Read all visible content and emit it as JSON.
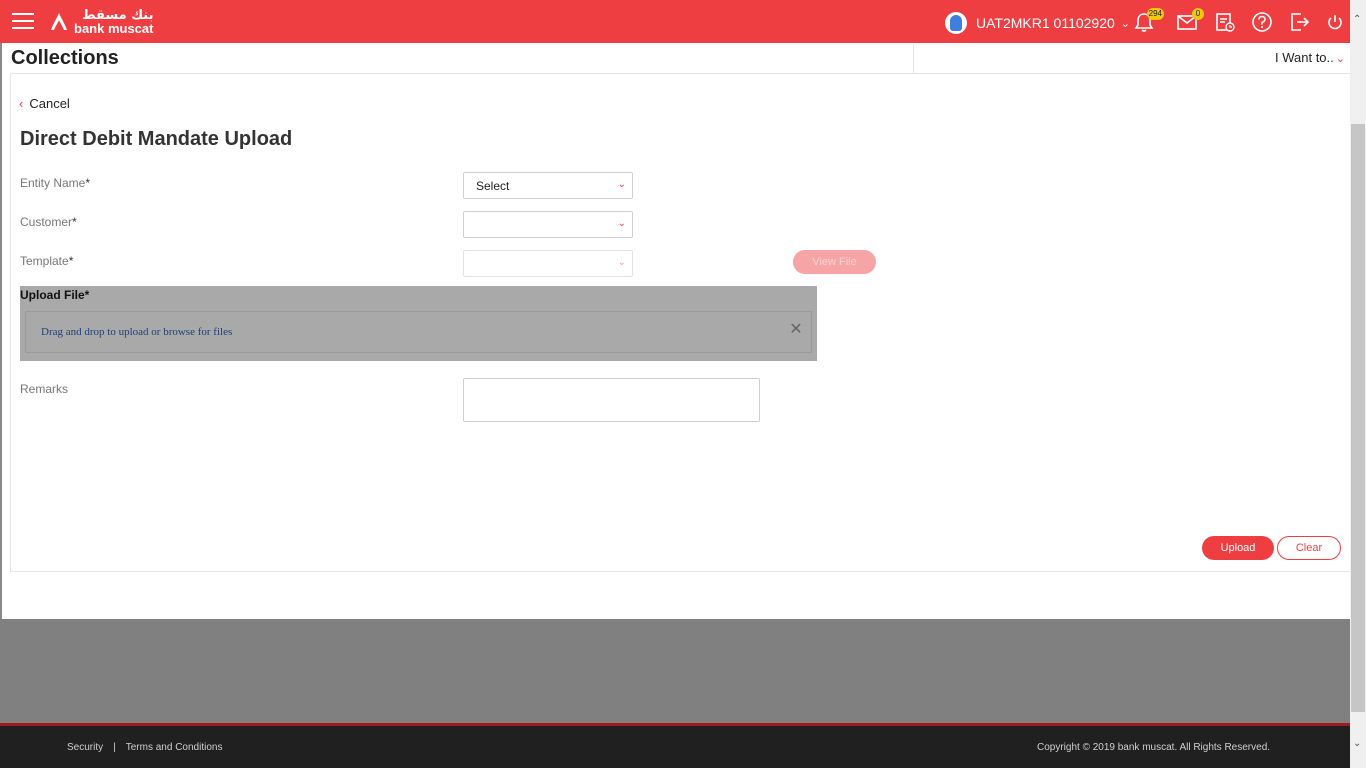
{
  "header": {
    "logo_arabic": "بنك مسقط",
    "logo_english": "bank muscat",
    "user_name": "UAT2MKR1 01102920",
    "notifications_count": "294",
    "mail_count": "0",
    "icons": [
      "menu-icon",
      "user-avatar-icon",
      "chevron-down-icon",
      "bell-icon",
      "mail-icon",
      "activity-log-icon",
      "help-icon",
      "logout-icon",
      "power-icon"
    ],
    "brand_color": "#ef3e42",
    "badge_color": "#f2c80f"
  },
  "page": {
    "title": "Collections",
    "i_want_to": "I Want to.."
  },
  "form": {
    "cancel_label": "Cancel",
    "title": "Direct Debit Mandate Upload",
    "entity_label": "Entity Name",
    "entity_value": "Select",
    "customer_label": "Customer",
    "customer_value": "",
    "template_label": "Template",
    "template_value": "",
    "view_file_label": "View File",
    "upload_file_label": "Upload File*",
    "drop_text": "Drag and drop to upload or browse for files",
    "remarks_label": "Remarks",
    "required_mark": "*",
    "upload_button": "Upload",
    "clear_button": "Clear"
  },
  "footer": {
    "security": "Security",
    "separator": "|",
    "terms": "Terms and Conditions",
    "copyright": "Copyright © 2019 bank muscat. All Rights Reserved."
  }
}
